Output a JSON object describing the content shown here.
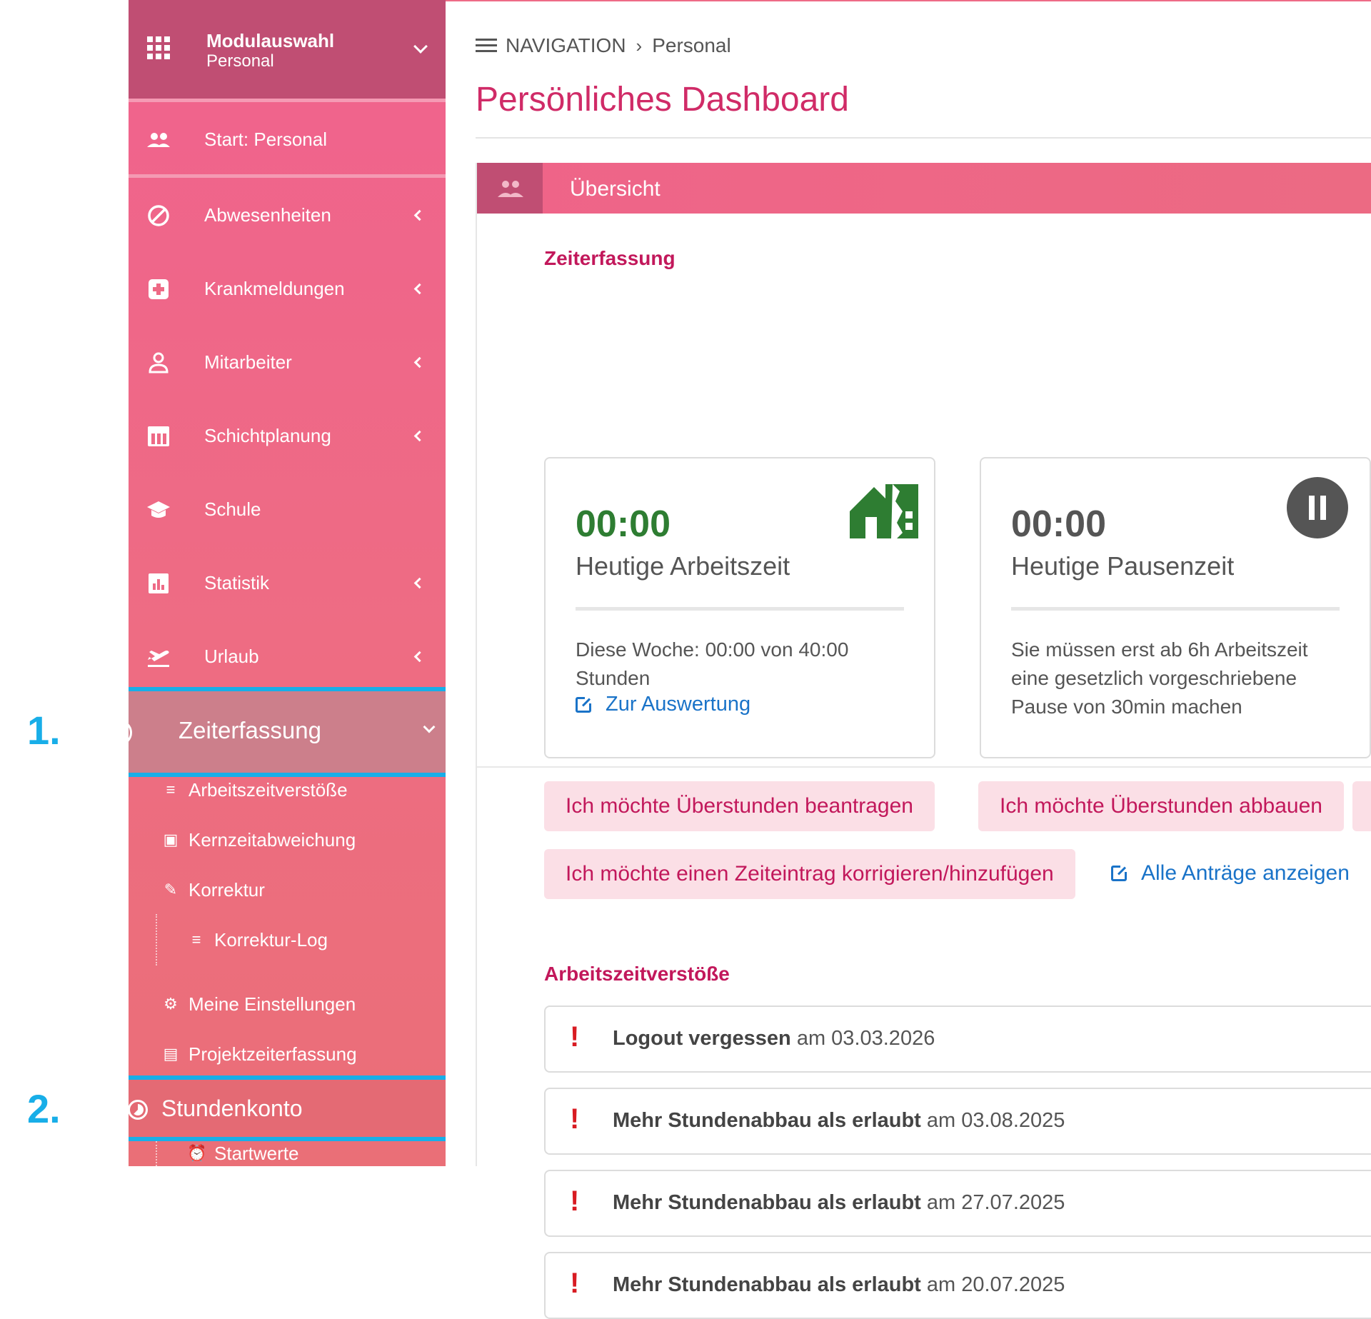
{
  "annotations": {
    "step1": "1.",
    "step2": "2."
  },
  "sidebar": {
    "module_title": "Modulauswahl",
    "module_sub": "Personal",
    "start": "Start: Personal",
    "items": [
      {
        "label": "Abwesenheiten",
        "icon": "block-icon"
      },
      {
        "label": "Krankmeldungen",
        "icon": "medical-plus-icon"
      },
      {
        "label": "Mitarbeiter",
        "icon": "person-icon"
      },
      {
        "label": "Schichtplanung",
        "icon": "calendar-table-icon"
      },
      {
        "label": "Schule",
        "icon": "graduation-cap-icon"
      },
      {
        "label": "Statistik",
        "icon": "bar-chart-icon"
      },
      {
        "label": "Urlaub",
        "icon": "plane-departure-icon"
      }
    ],
    "active": "Zeiterfassung",
    "subitems": [
      {
        "label": "Arbeitszeitverstöße",
        "icon": "list-icon"
      },
      {
        "label": "Kernzeitabweichung",
        "icon": "calendar-icon"
      },
      {
        "label": "Korrektur",
        "icon": "pencil-icon"
      },
      {
        "label": "Korrektur-Log",
        "icon": "list-icon"
      },
      {
        "label": "Meine Einstellungen",
        "icon": "gear-icon"
      },
      {
        "label": "Projektzeiterfassung",
        "icon": "briefcase-clock-icon"
      }
    ],
    "stundenkonto": "Stundenkonto",
    "startwerte": "Startwerte"
  },
  "breadcrumb": {
    "root": "NAVIGATION",
    "current": "Personal"
  },
  "page_title": "Persönliches Dashboard",
  "panel": {
    "title": "Übersicht"
  },
  "zeiterfassung": {
    "title": "Zeiterfassung",
    "work": {
      "time": "00:00",
      "caption": "Heutige Arbeitszeit",
      "desc": "Diese Woche: 00:00 von 40:00 Stunden",
      "link": "Zur Auswertung"
    },
    "pause": {
      "time": "00:00",
      "caption": "Heutige Pausenzeit",
      "desc": "Sie müssen erst ab 6h Arbeitszeit eine gesetzlich vorgeschriebene Pause von 30min machen"
    },
    "buttons": {
      "beantragen": "Ich möchte Überstunden beantragen",
      "abbauen": "Ich möchte Überstunden abbauen",
      "korrigieren": "Ich möchte einen Zeiteintrag korrigieren/hinzufügen",
      "alle": "Alle Anträge anzeigen"
    }
  },
  "violations": {
    "title": "Arbeitszeitverstöße",
    "items": [
      {
        "bold": "Logout vergessen",
        "rest": " am 03.03.2026"
      },
      {
        "bold": "Mehr Stundenabbau als erlaubt",
        "rest": " am 03.08.2025"
      },
      {
        "bold": "Mehr Stundenabbau als erlaubt",
        "rest": " am 27.07.2025"
      },
      {
        "bold": "Mehr Stundenabbau als erlaubt",
        "rest": " am 20.07.2025"
      }
    ]
  },
  "colors": {
    "accent": "#ee6a86",
    "brand_dark": "#c04e73",
    "highlight": "#18aee8",
    "work_green": "#2e7d32"
  }
}
